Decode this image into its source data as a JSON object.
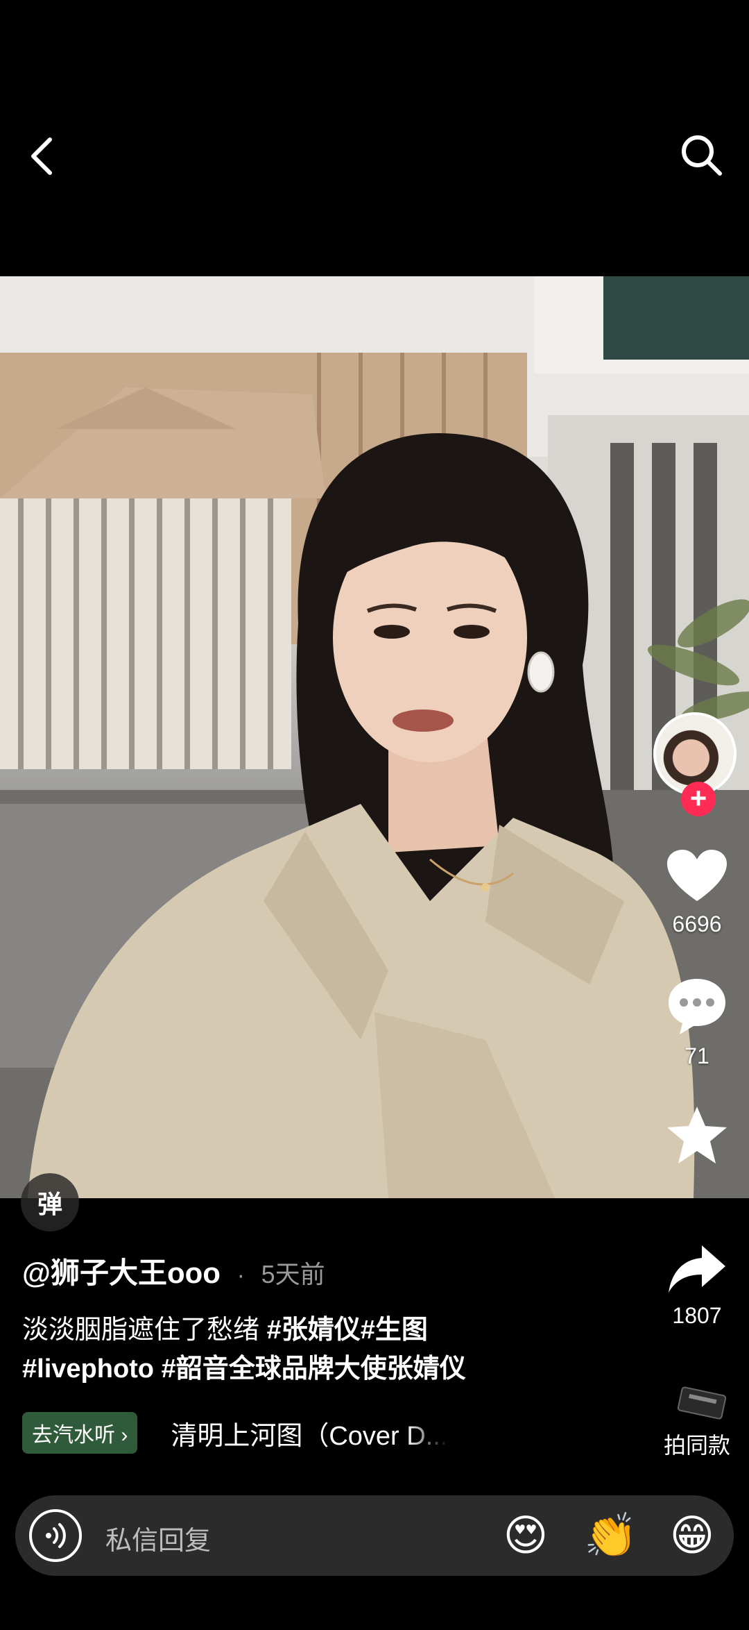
{
  "author": {
    "handle": "@狮子大王ooo",
    "separator": "·",
    "posted": "5天前"
  },
  "caption": {
    "line1_text": "淡淡胭脂遮住了愁绪 ",
    "line1_tags": "#张婧仪#生图",
    "line2_tags": "#livephoto #韶音全球品牌大使张婧仪"
  },
  "music": {
    "chip_label": "去汽水听 ›",
    "title": "清明上河图（Cover D..."
  },
  "actions": {
    "likes": "6696",
    "comments": "71",
    "favorites": "",
    "shares": "1807",
    "remix_label": "拍同款"
  },
  "danmu": {
    "label": "弹"
  },
  "reply": {
    "placeholder": "私信回复",
    "emoji_1": "😍",
    "emoji_2": "👏",
    "emoji_3": "😁"
  },
  "colors": {
    "follow_accent": "#fe2c55",
    "music_chip": "#2f5b3a",
    "reply_bar": "#2b2b2b"
  },
  "icons": [
    "back-arrow-icon",
    "search-icon",
    "heart-icon",
    "comment-icon",
    "star-icon",
    "share-arrow-icon",
    "voice-icon",
    "plus-icon"
  ]
}
